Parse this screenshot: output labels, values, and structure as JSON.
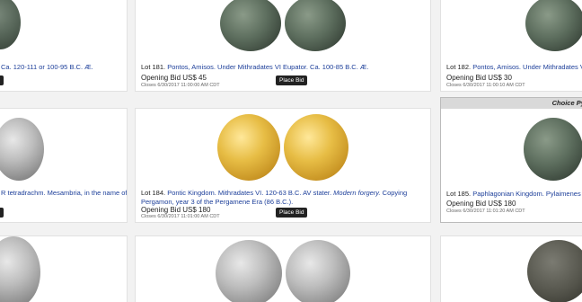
{
  "cards": {
    "c180": {
      "lot_text": "Ca. 120-111 or 100-95 B.C. Æ."
    },
    "c181": {
      "lot_num": "Lot 181.",
      "title": "Pontos, Amisos. Under Mithradates VI Eupator. Ca. 100-85 B.C. Æ.",
      "opening_bid": "Opening Bid  US$ 45",
      "closes": "Closes 6/30/2017 11:00:00 AM CDT",
      "button": "Place Bid"
    },
    "c182": {
      "lot_num": "Lot 182.",
      "title": "Pontos, Amisos. Under Mithradates VI",
      "opening_bid": "Opening Bid  US$ 30",
      "closes": "Closes 6/30/2017 11:00:10 AM CDT"
    },
    "c183": {
      "lot_text": "R tetradrachm. Mesambria, in the name of"
    },
    "c184": {
      "lot_num": "Lot 184.",
      "title_a": "Pontic Kingdom. Mithradates VI. 120-63 B.C. AV stater.",
      "title_em": "Modern forgery.",
      "title_b": "Copying",
      "title_line2": "Pergamon, year 3 of the Pergamene Era (86 B.C.).",
      "opening_bid": "Opening Bid  US$ 180",
      "closes": "Closes 6/30/2017 11:01:00 AM CDT",
      "button": "Place Bid"
    },
    "c185": {
      "ribbon": "Choice Pyl",
      "lot_num": "Lot 185.",
      "title": "Paphlagonian Kingdom. Pylaimenes II",
      "opening_bid": "Opening Bid  US$ 180",
      "closes": "Closes 6/30/2017 11:01:20 AM CDT"
    }
  }
}
